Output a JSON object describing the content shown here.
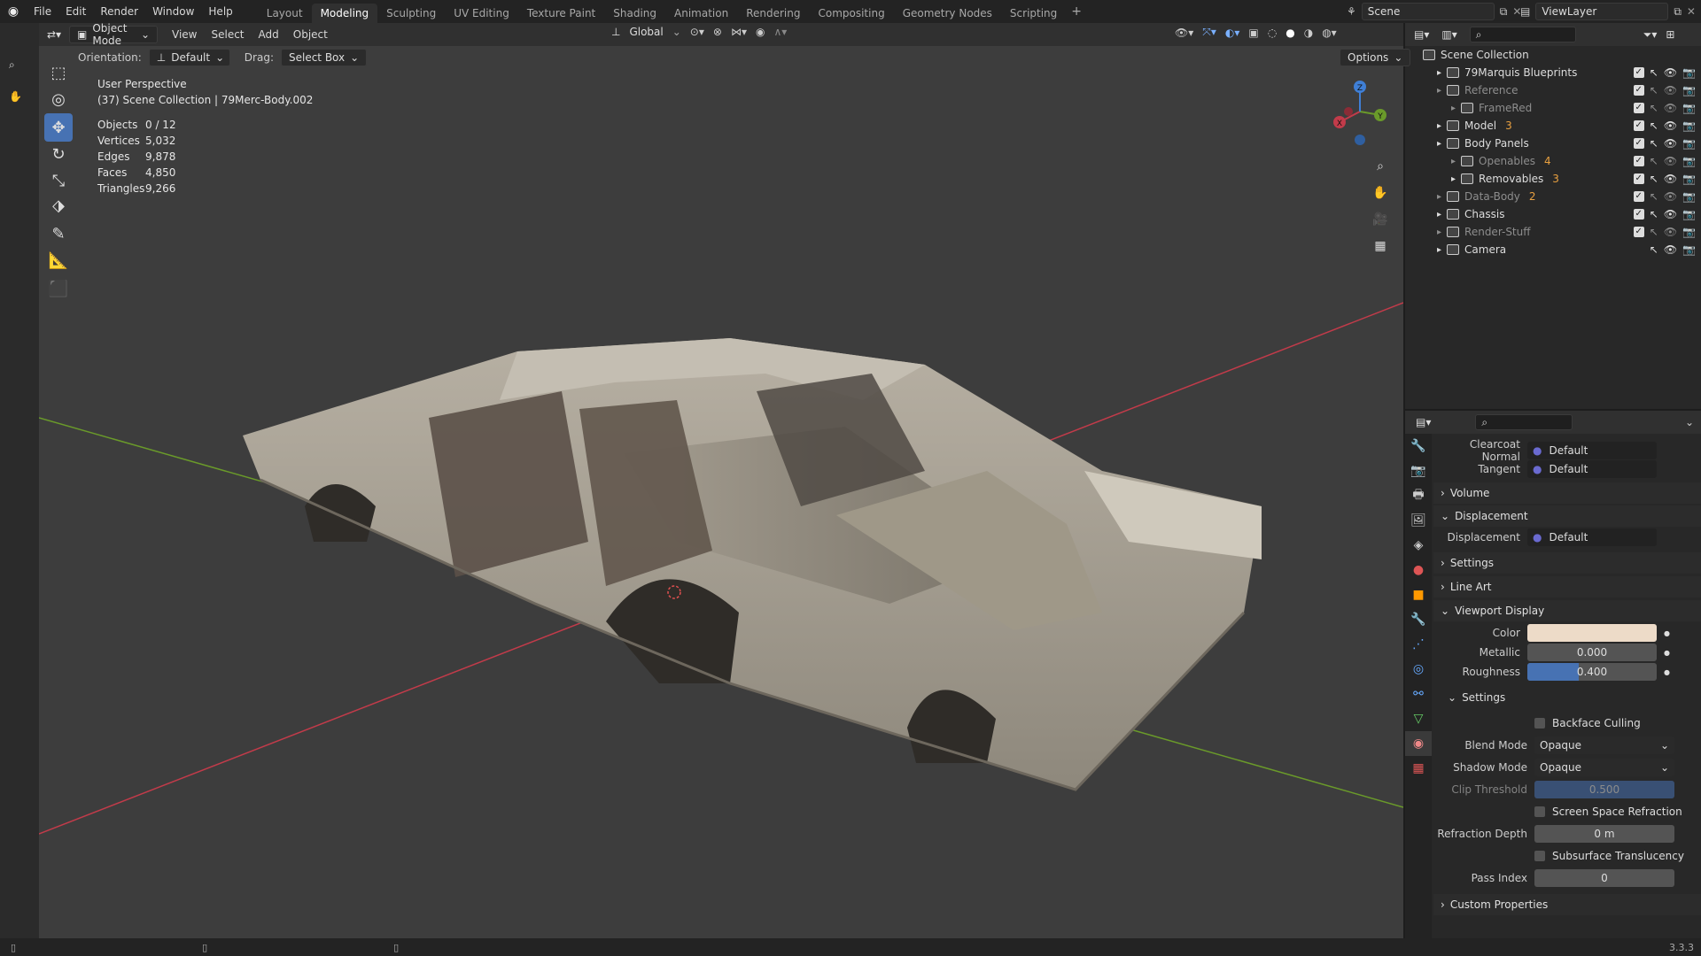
{
  "menu": {
    "file": "File",
    "edit": "Edit",
    "render": "Render",
    "window": "Window",
    "help": "Help"
  },
  "workspaces": [
    "Layout",
    "Modeling",
    "Sculpting",
    "UV Editing",
    "Texture Paint",
    "Shading",
    "Animation",
    "Rendering",
    "Compositing",
    "Geometry Nodes",
    "Scripting"
  ],
  "active_workspace": "Modeling",
  "scene_name": "Scene",
  "view_layer": "ViewLayer",
  "view_header": {
    "mode": "Object Mode",
    "view": "View",
    "select": "Select",
    "add": "Add",
    "object": "Object",
    "transform": "Global"
  },
  "tool_header": {
    "orientation_label": "Orientation:",
    "orientation_value": "Default",
    "drag_label": "Drag:",
    "drag_value": "Select Box",
    "options": "Options"
  },
  "overlay_info": {
    "perspective": "User Perspective",
    "collection": "(37) Scene Collection | 79Merc-Body.002"
  },
  "stats": [
    {
      "label": "Objects",
      "value": "0 / 12"
    },
    {
      "label": "Vertices",
      "value": "5,032"
    },
    {
      "label": "Edges",
      "value": "9,878"
    },
    {
      "label": "Faces",
      "value": "4,850"
    },
    {
      "label": "Triangles",
      "value": "9,266"
    }
  ],
  "outliner": {
    "root": "Scene Collection",
    "items": [
      {
        "name": "79Marquis Blueprints",
        "dim": false,
        "badge": ""
      },
      {
        "name": "Reference",
        "dim": true,
        "badge": ""
      },
      {
        "name": "FrameRed",
        "dim": true,
        "badge": ""
      },
      {
        "name": "Model",
        "dim": false,
        "badge": "3"
      },
      {
        "name": "Body Panels",
        "dim": false,
        "badge": ""
      },
      {
        "name": "Openables",
        "dim": true,
        "badge": "4"
      },
      {
        "name": "Removables",
        "dim": false,
        "badge": "3"
      },
      {
        "name": "Data-Body",
        "dim": true,
        "badge": "2"
      },
      {
        "name": "Chassis",
        "dim": false,
        "badge": ""
      },
      {
        "name": "Render-Stuff",
        "dim": true,
        "badge": ""
      },
      {
        "name": "Camera",
        "dim": false,
        "badge": ""
      }
    ]
  },
  "props": {
    "clearcoat_normal_label": "Clearcoat Normal",
    "clearcoat_normal_value": "Default",
    "tangent_label": "Tangent",
    "tangent_value": "Default",
    "volume": "Volume",
    "displacement_section": "Displacement",
    "displacement_label": "Displacement",
    "displacement_value": "Default",
    "settings": "Settings",
    "line_art": "Line Art",
    "viewport_display": "Viewport Display",
    "color_label": "Color",
    "color_value": "#eddbc8",
    "metallic_label": "Metallic",
    "metallic_value": "0.000",
    "metallic_fraction": 0.0,
    "roughness_label": "Roughness",
    "roughness_value": "0.400",
    "roughness_fraction": 0.4,
    "settings_sub": "Settings",
    "backface_culling": "Backface Culling",
    "blend_mode_label": "Blend Mode",
    "blend_mode_value": "Opaque",
    "shadow_mode_label": "Shadow Mode",
    "shadow_mode_value": "Opaque",
    "clip_threshold_label": "Clip Threshold",
    "clip_threshold_value": "0.500",
    "screen_space_refraction": "Screen Space Refraction",
    "refraction_depth_label": "Refraction Depth",
    "refraction_depth_value": "0 m",
    "subsurface_translucency": "Subsurface Translucency",
    "pass_index_label": "Pass Index",
    "pass_index_value": "0",
    "custom_properties": "Custom Properties"
  },
  "version": "3.3.3",
  "colors": {
    "accent": "#4772b3",
    "viewport_bg": "#3d3d3d",
    "x_axis": "#c23b4a",
    "y_axis": "#6a9a2a",
    "z_axis": "#3f7fd6"
  }
}
